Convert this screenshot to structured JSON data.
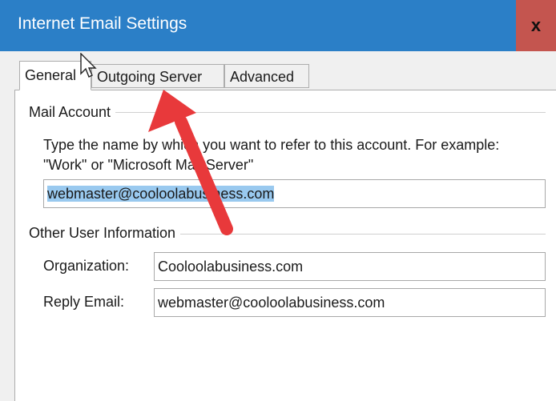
{
  "window": {
    "title": "Internet Email Settings",
    "close_label": "x"
  },
  "tabs": [
    {
      "label": "General"
    },
    {
      "label": "Outgoing Server"
    },
    {
      "label": "Advanced"
    }
  ],
  "mail_account": {
    "group_label": "Mail Account",
    "description": "Type the name by which you want to refer to this account. For example: \"Work\" or \"Microsoft Mail Server\"",
    "account_name_value": "webmaster@cooloolabusiness.com"
  },
  "other_user_info": {
    "group_label": "Other User Information",
    "organization_label": "Organization:",
    "organization_value": "Cooloolabusiness.com",
    "reply_email_label": "Reply Email:",
    "reply_email_value": "webmaster@cooloolabusiness.com"
  },
  "colors": {
    "titlebar": "#2b7fc7",
    "close_button": "#c4554f",
    "annotation_arrow": "#e8393b",
    "selection": "#99c9ef"
  },
  "icons": {
    "cursor": "mouse-pointer-icon",
    "annotation": "red-arrow-annotation"
  }
}
